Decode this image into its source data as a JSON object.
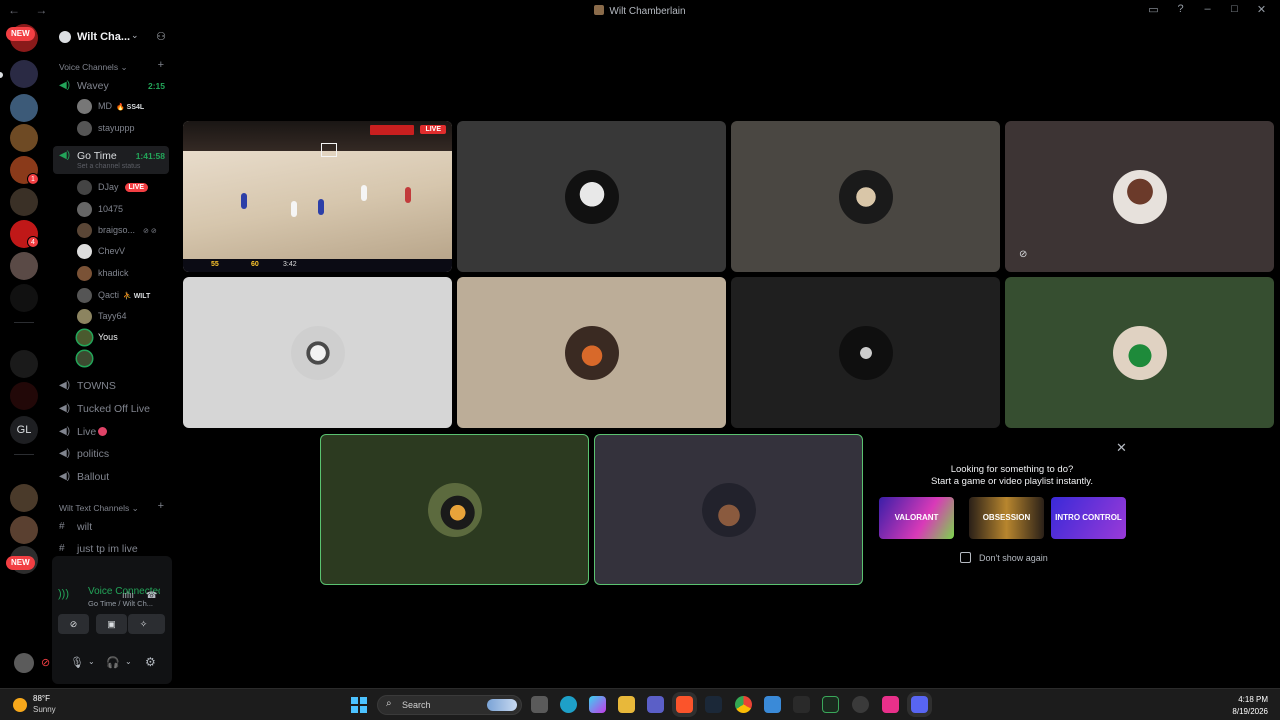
{
  "window": {
    "title": "Wilt Chamberlain",
    "nav": "← →"
  },
  "rail": {
    "new_badge_top": "NEW",
    "new_badge_bottom": "NEW",
    "badge_1": "1",
    "badge_2": "4",
    "gl_label": "GL"
  },
  "guild": {
    "name": "Wilt Cha..."
  },
  "voice_category": "Voice Channels",
  "text_category": "Wilt Text Channels",
  "channels": {
    "wavey": {
      "name": "Wavey",
      "time": "2:15"
    },
    "gotime": {
      "name": "Go Time",
      "time": "1:41:58",
      "status": "Set a channel status"
    },
    "towns": "TOWNS",
    "tucked": "Tucked Off Live",
    "live": "Live",
    "politics": "politics",
    "ballout": "Ballout",
    "wilt": "wilt",
    "justtp": "just tp im live"
  },
  "wavey_users": [
    {
      "name": "MD",
      "tag": "SS4L"
    },
    {
      "name": "stayuppp"
    }
  ],
  "gotime_users": [
    {
      "name": "DJay",
      "badge": "LIVE"
    },
    {
      "name": "10475"
    },
    {
      "name": "braigso..."
    },
    {
      "name": "ChevV"
    },
    {
      "name": "khadick"
    },
    {
      "name": "Qacti",
      "tag": "WILT"
    },
    {
      "name": "Tayy64"
    },
    {
      "name": "Yous"
    }
  ],
  "voice": {
    "title": "Voice Connected",
    "subtitle": "Go Time / Wilt Ch..."
  },
  "stream": {
    "live": "LIVE",
    "score_home": "55",
    "score_away": "60",
    "clock": "3:42"
  },
  "activity": {
    "line1": "Looking for something to do?",
    "line2": "Start a game or video playlist instantly.",
    "cards": [
      "VALORANT",
      "OBSESSION",
      "INTRO CONTROL"
    ],
    "dont_show": "Don't show again"
  },
  "taskbar": {
    "temp": "88°F",
    "weather": "Sunny",
    "search": "Search",
    "time": "4:18 PM",
    "date": "8/19/2026"
  },
  "colors": {
    "speaking": "#5ac270",
    "live": "#f23f43",
    "connected": "#23a559"
  }
}
